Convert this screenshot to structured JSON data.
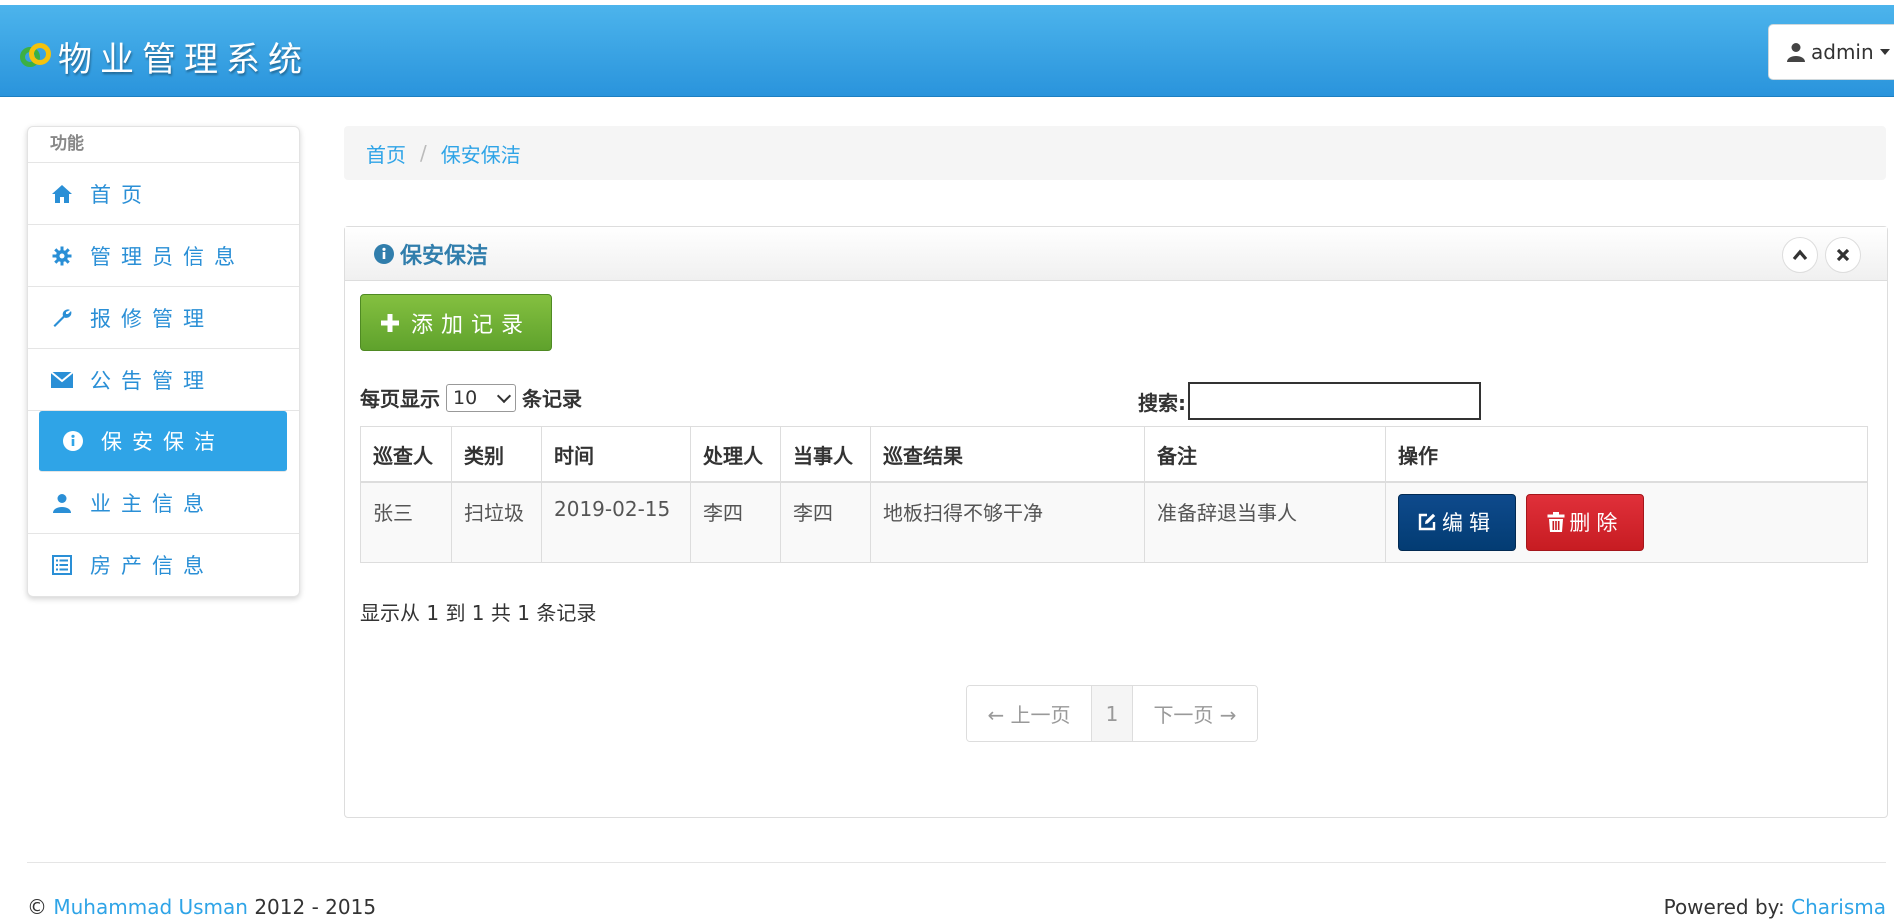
{
  "brand": {
    "title": "物业管理系统"
  },
  "user_menu": {
    "label": "admin"
  },
  "sidebar": {
    "header": "功能",
    "items": [
      {
        "label": "首页",
        "icon": "home-icon"
      },
      {
        "label": "管理员信息",
        "icon": "gear-icon"
      },
      {
        "label": "报修管理",
        "icon": "wrench-icon"
      },
      {
        "label": "公告管理",
        "icon": "envelope-icon"
      },
      {
        "label": "保安保洁",
        "icon": "info-icon",
        "active": true
      },
      {
        "label": "业主信息",
        "icon": "user-icon"
      },
      {
        "label": "房产信息",
        "icon": "list-icon"
      }
    ]
  },
  "breadcrumb": {
    "home": "首页",
    "separator": "/",
    "current": "保安保洁"
  },
  "panel": {
    "title": "保安保洁",
    "add_button": "添加记录",
    "length_prefix": "每页显示",
    "length_value": "10",
    "length_suffix": "条记录",
    "search_label": "搜索:",
    "search_value": "",
    "table": {
      "columns": [
        "巡查人",
        "类别",
        "时间",
        "处理人",
        "当事人",
        "巡查结果",
        "备注",
        "操作"
      ],
      "rows": [
        {
          "inspector": "张三",
          "category": "扫垃圾",
          "time": "2019-02-15",
          "handler": "李四",
          "party": "李四",
          "result": "地板扫得不够干净",
          "remark": "准备辞退当事人"
        }
      ],
      "edit_label": "编辑",
      "delete_label": "删除"
    },
    "info": "显示从 1 到 1 共 1 条记录",
    "pager": {
      "prev": "← 上一页",
      "current": "1",
      "next": "下一页 →"
    }
  },
  "footer": {
    "copyright_symbol": "©",
    "author": "Muhammad Usman",
    "years": "2012 - 2015",
    "powered_prefix": "Powered by:",
    "powered_link": "Charisma"
  },
  "colors": {
    "navbar": "#2fa4e7",
    "link": "#2fa4e7",
    "add_button": "#73a839",
    "edit_button": "#033c73",
    "delete_button": "#c71c22"
  }
}
